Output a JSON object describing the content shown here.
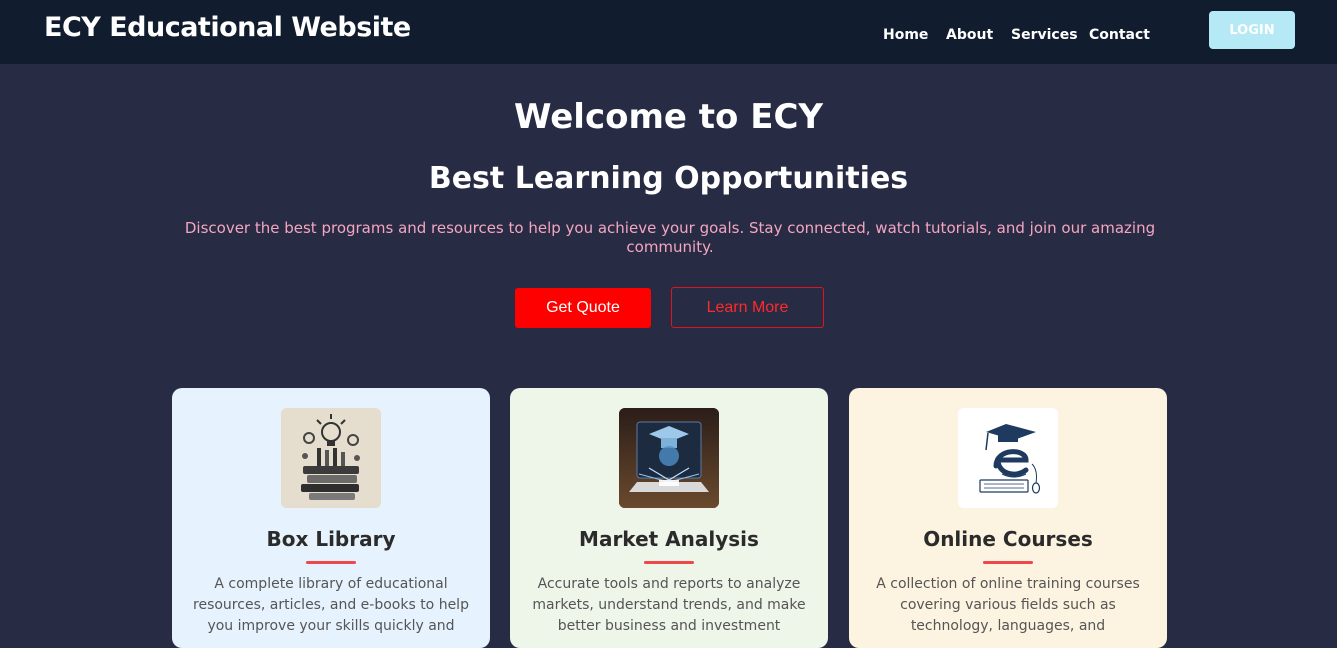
{
  "navbar": {
    "brand": "ECY Educational Website",
    "links": [
      "Home",
      "About",
      "Services",
      "Contact"
    ],
    "login_label": "LOGIN"
  },
  "hero": {
    "title": "Welcome to ECY",
    "subtitle": "Best Learning Opportunities",
    "description": "Discover the best programs and resources to help you achieve your goals. Stay connected, watch tutorials, and join our amazing community.",
    "primary_button": "Get Quote",
    "secondary_button": "Learn More"
  },
  "cards": [
    {
      "title": "Box Library",
      "text": "A complete library of educational resources, articles, and e-books to help you improve your skills quickly and",
      "icon": "library-books-icon",
      "background": "#e6f2fd"
    },
    {
      "title": "Market Analysis",
      "text": "Accurate tools and reports to analyze markets, understand trends, and make better business and investment",
      "icon": "graduation-tech-icon",
      "background": "#eef5e9"
    },
    {
      "title": "Online Courses",
      "text": "A collection of online training courses covering various fields such as technology, languages, and",
      "icon": "elearning-icon",
      "background": "#fdf3e1"
    }
  ],
  "colors": {
    "navbar_bg": "#111c2e",
    "page_bg": "#272b44",
    "accent_red": "#ff0000",
    "login_bg": "#b5e9f6",
    "description_pink": "#f4a6c0",
    "underline": "#f0474b"
  }
}
